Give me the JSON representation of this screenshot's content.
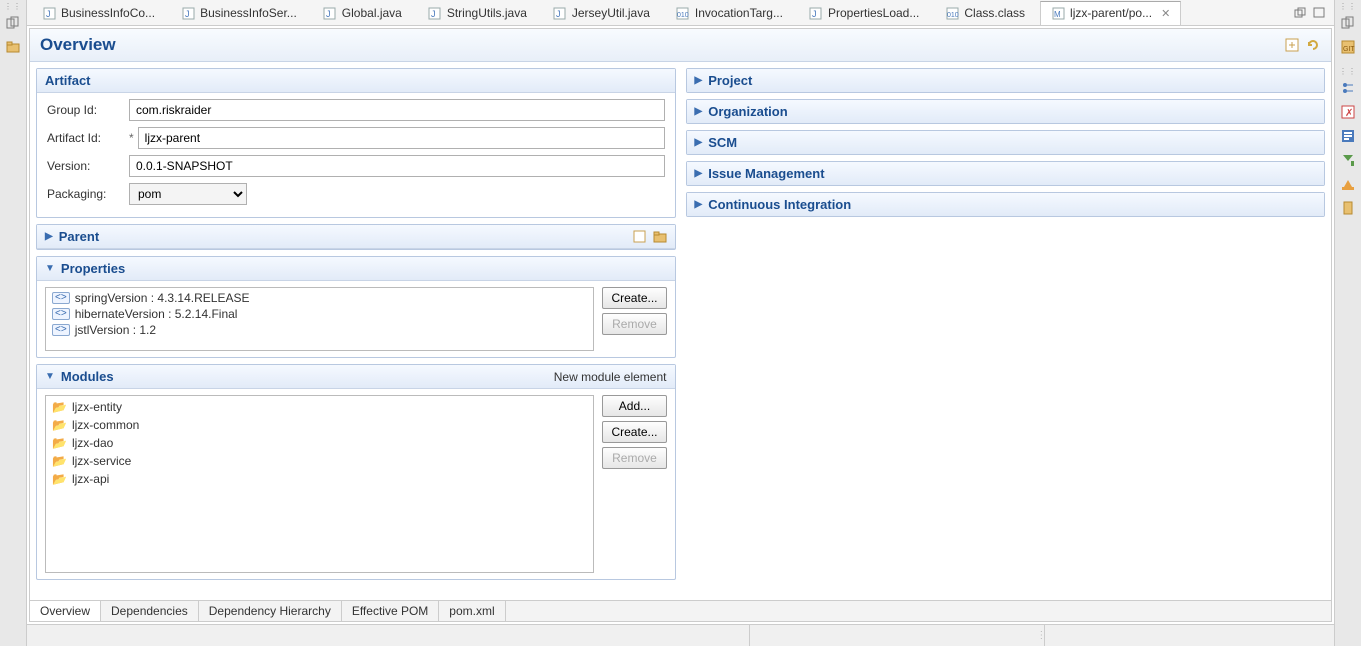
{
  "tabs": [
    {
      "label": "BusinessInfoCo...",
      "active": false,
      "icon": "java"
    },
    {
      "label": "BusinessInfoSer...",
      "active": false,
      "icon": "java"
    },
    {
      "label": "Global.java",
      "active": false,
      "icon": "java"
    },
    {
      "label": "StringUtils.java",
      "active": false,
      "icon": "java"
    },
    {
      "label": "JerseyUtil.java",
      "active": false,
      "icon": "java"
    },
    {
      "label": "InvocationTarg...",
      "active": false,
      "icon": "class"
    },
    {
      "label": "PropertiesLoad...",
      "active": false,
      "icon": "java"
    },
    {
      "label": "Class.class",
      "active": false,
      "icon": "class"
    },
    {
      "label": "ljzx-parent/po...",
      "active": true,
      "icon": "maven"
    }
  ],
  "overview": {
    "title": "Overview"
  },
  "artifact": {
    "heading": "Artifact",
    "groupIdLabel": "Group Id:",
    "groupId": "com.riskraider",
    "artifactIdLabel": "Artifact Id:",
    "artifactId": "ljzx-parent",
    "versionLabel": "Version:",
    "version": "0.0.1-SNAPSHOT",
    "packagingLabel": "Packaging:",
    "packaging": "pom"
  },
  "parent": {
    "heading": "Parent"
  },
  "properties": {
    "heading": "Properties",
    "items": [
      "springVersion : 4.3.14.RELEASE",
      "hibernateVersion : 5.2.14.Final",
      "jstlVersion : 1.2"
    ],
    "createLabel": "Create...",
    "removeLabel": "Remove"
  },
  "modules": {
    "heading": "Modules",
    "newHint": "New module element",
    "items": [
      "ljzx-entity",
      "ljzx-common",
      "ljzx-dao",
      "ljzx-service",
      "ljzx-api"
    ],
    "addLabel": "Add...",
    "createLabel": "Create...",
    "removeLabel": "Remove"
  },
  "rightSections": {
    "project": "Project",
    "organization": "Organization",
    "scm": "SCM",
    "issue": "Issue Management",
    "ci": "Continuous Integration"
  },
  "bottomTabs": {
    "overview": "Overview",
    "dependencies": "Dependencies",
    "dependencyHierarchy": "Dependency Hierarchy",
    "effectivePom": "Effective POM",
    "pomXml": "pom.xml"
  }
}
